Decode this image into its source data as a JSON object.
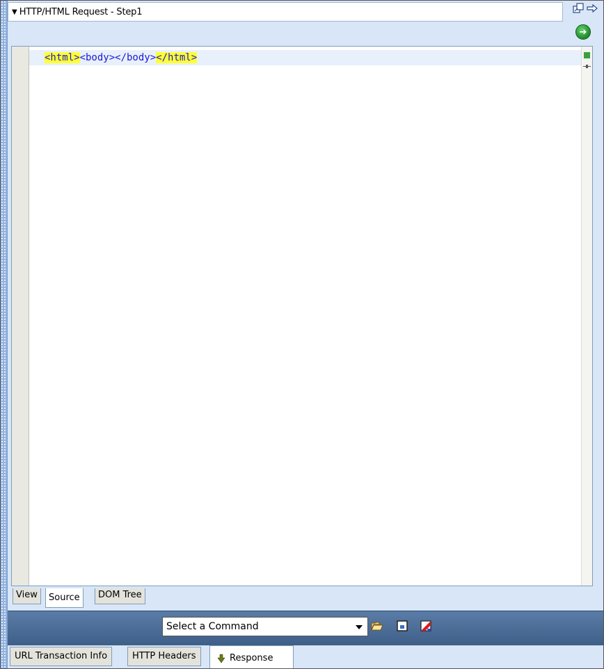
{
  "panel": {
    "title": "HTTP/HTML Request - Step1"
  },
  "icons": {
    "undock": "undock-icon",
    "forward": "arrow-right-icon",
    "go": "green-go-icon"
  },
  "editor": {
    "lines": [
      {
        "open_html": "<html>",
        "body": "<body></body>",
        "close_html": "</html>"
      }
    ]
  },
  "view_tabs": [
    {
      "label": "View"
    },
    {
      "label": "Source",
      "active": true
    },
    {
      "label": "DOM Tree"
    }
  ],
  "command_bar": {
    "select_value": "Select a Command"
  },
  "bottom_tabs": [
    {
      "label": "URL Transaction Info"
    },
    {
      "label": "HTTP Headers"
    },
    {
      "label": "Response",
      "active": true
    }
  ],
  "colors": {
    "highlight": "#ffff33",
    "tag_text": "#1a1ad6",
    "command_bar": "#4a6c96"
  }
}
